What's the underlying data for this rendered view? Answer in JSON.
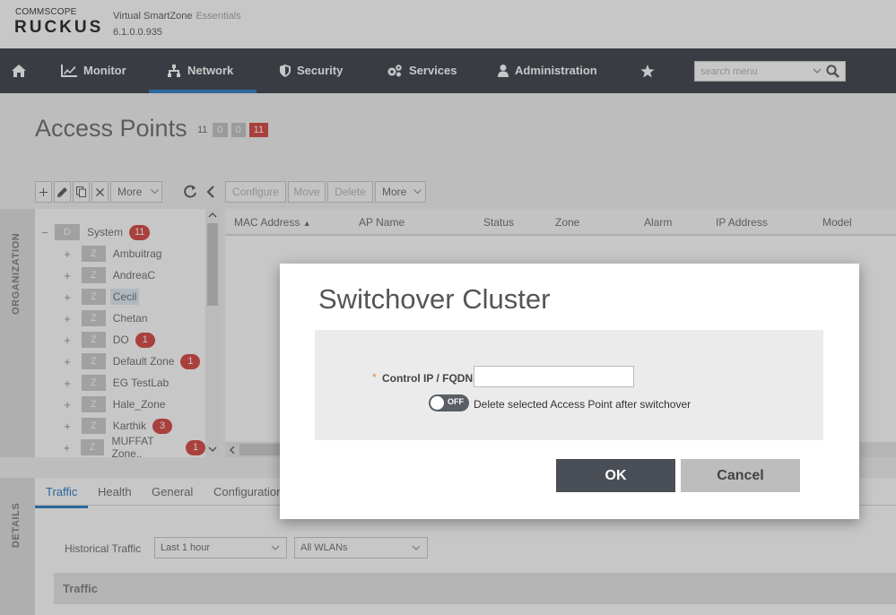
{
  "header": {
    "logo_top": "COMMSCOPE",
    "logo_main": "RUCKUS",
    "product": "Virtual SmartZone",
    "edition": "Essentials",
    "version": "6.1.0.0.935"
  },
  "nav": {
    "items": [
      {
        "label": "Monitor",
        "icon": "monitor-icon"
      },
      {
        "label": "Network",
        "icon": "network-icon",
        "active": true
      },
      {
        "label": "Security",
        "icon": "shield-icon"
      },
      {
        "label": "Services",
        "icon": "gears-icon"
      },
      {
        "label": "Administration",
        "icon": "user-icon"
      }
    ],
    "search_placeholder": "search menu"
  },
  "page": {
    "title": "Access Points",
    "counts": [
      "11",
      "0",
      "0",
      "11"
    ]
  },
  "toolbar": {
    "tree_more": "More",
    "grid_buttons": [
      "Configure",
      "Move",
      "Delete",
      "More"
    ]
  },
  "sidebar": {
    "organization_label": "ORGANIZATION",
    "details_label": "DETAILS"
  },
  "tree": {
    "root": {
      "badge": "D",
      "label": "System",
      "count": "11"
    },
    "zones": [
      {
        "badge": "Z",
        "label": "Ambuitrag",
        "count": ""
      },
      {
        "badge": "Z",
        "label": "AndreaC",
        "count": ""
      },
      {
        "badge": "Z",
        "label": "Cecil",
        "count": "",
        "selected": true
      },
      {
        "badge": "Z",
        "label": "Chetan",
        "count": ""
      },
      {
        "badge": "Z",
        "label": "DO",
        "count": "1"
      },
      {
        "badge": "Z",
        "label": "Default Zone",
        "count": "1"
      },
      {
        "badge": "Z",
        "label": "EG TestLab",
        "count": ""
      },
      {
        "badge": "Z",
        "label": "Hale_Zone",
        "count": ""
      },
      {
        "badge": "Z",
        "label": "Karthik",
        "count": "3"
      },
      {
        "badge": "Z",
        "label": "MUFFAT Zone..",
        "count": "1"
      }
    ]
  },
  "grid": {
    "columns": [
      "MAC Address",
      "AP Name",
      "Status",
      "Zone",
      "Alarm",
      "IP Address",
      "Model"
    ]
  },
  "details": {
    "tabs": [
      "Traffic",
      "Health",
      "General",
      "Configuration"
    ],
    "historical_label": "Historical Traffic",
    "time_select": "Last 1 hour",
    "wlan_select": "All WLANs",
    "section_title": "Traffic"
  },
  "modal": {
    "title": "Switchover Cluster",
    "required_mark": "*",
    "field_label": "Control IP / FQDN:",
    "field_value": "",
    "toggle_state": "OFF",
    "toggle_label": "Delete selected Access Point after switchover",
    "ok_label": "OK",
    "cancel_label": "Cancel"
  },
  "colors": {
    "nav_bg": "#4a4f57",
    "accent": "#3a86c8",
    "alert": "#d9534f"
  }
}
